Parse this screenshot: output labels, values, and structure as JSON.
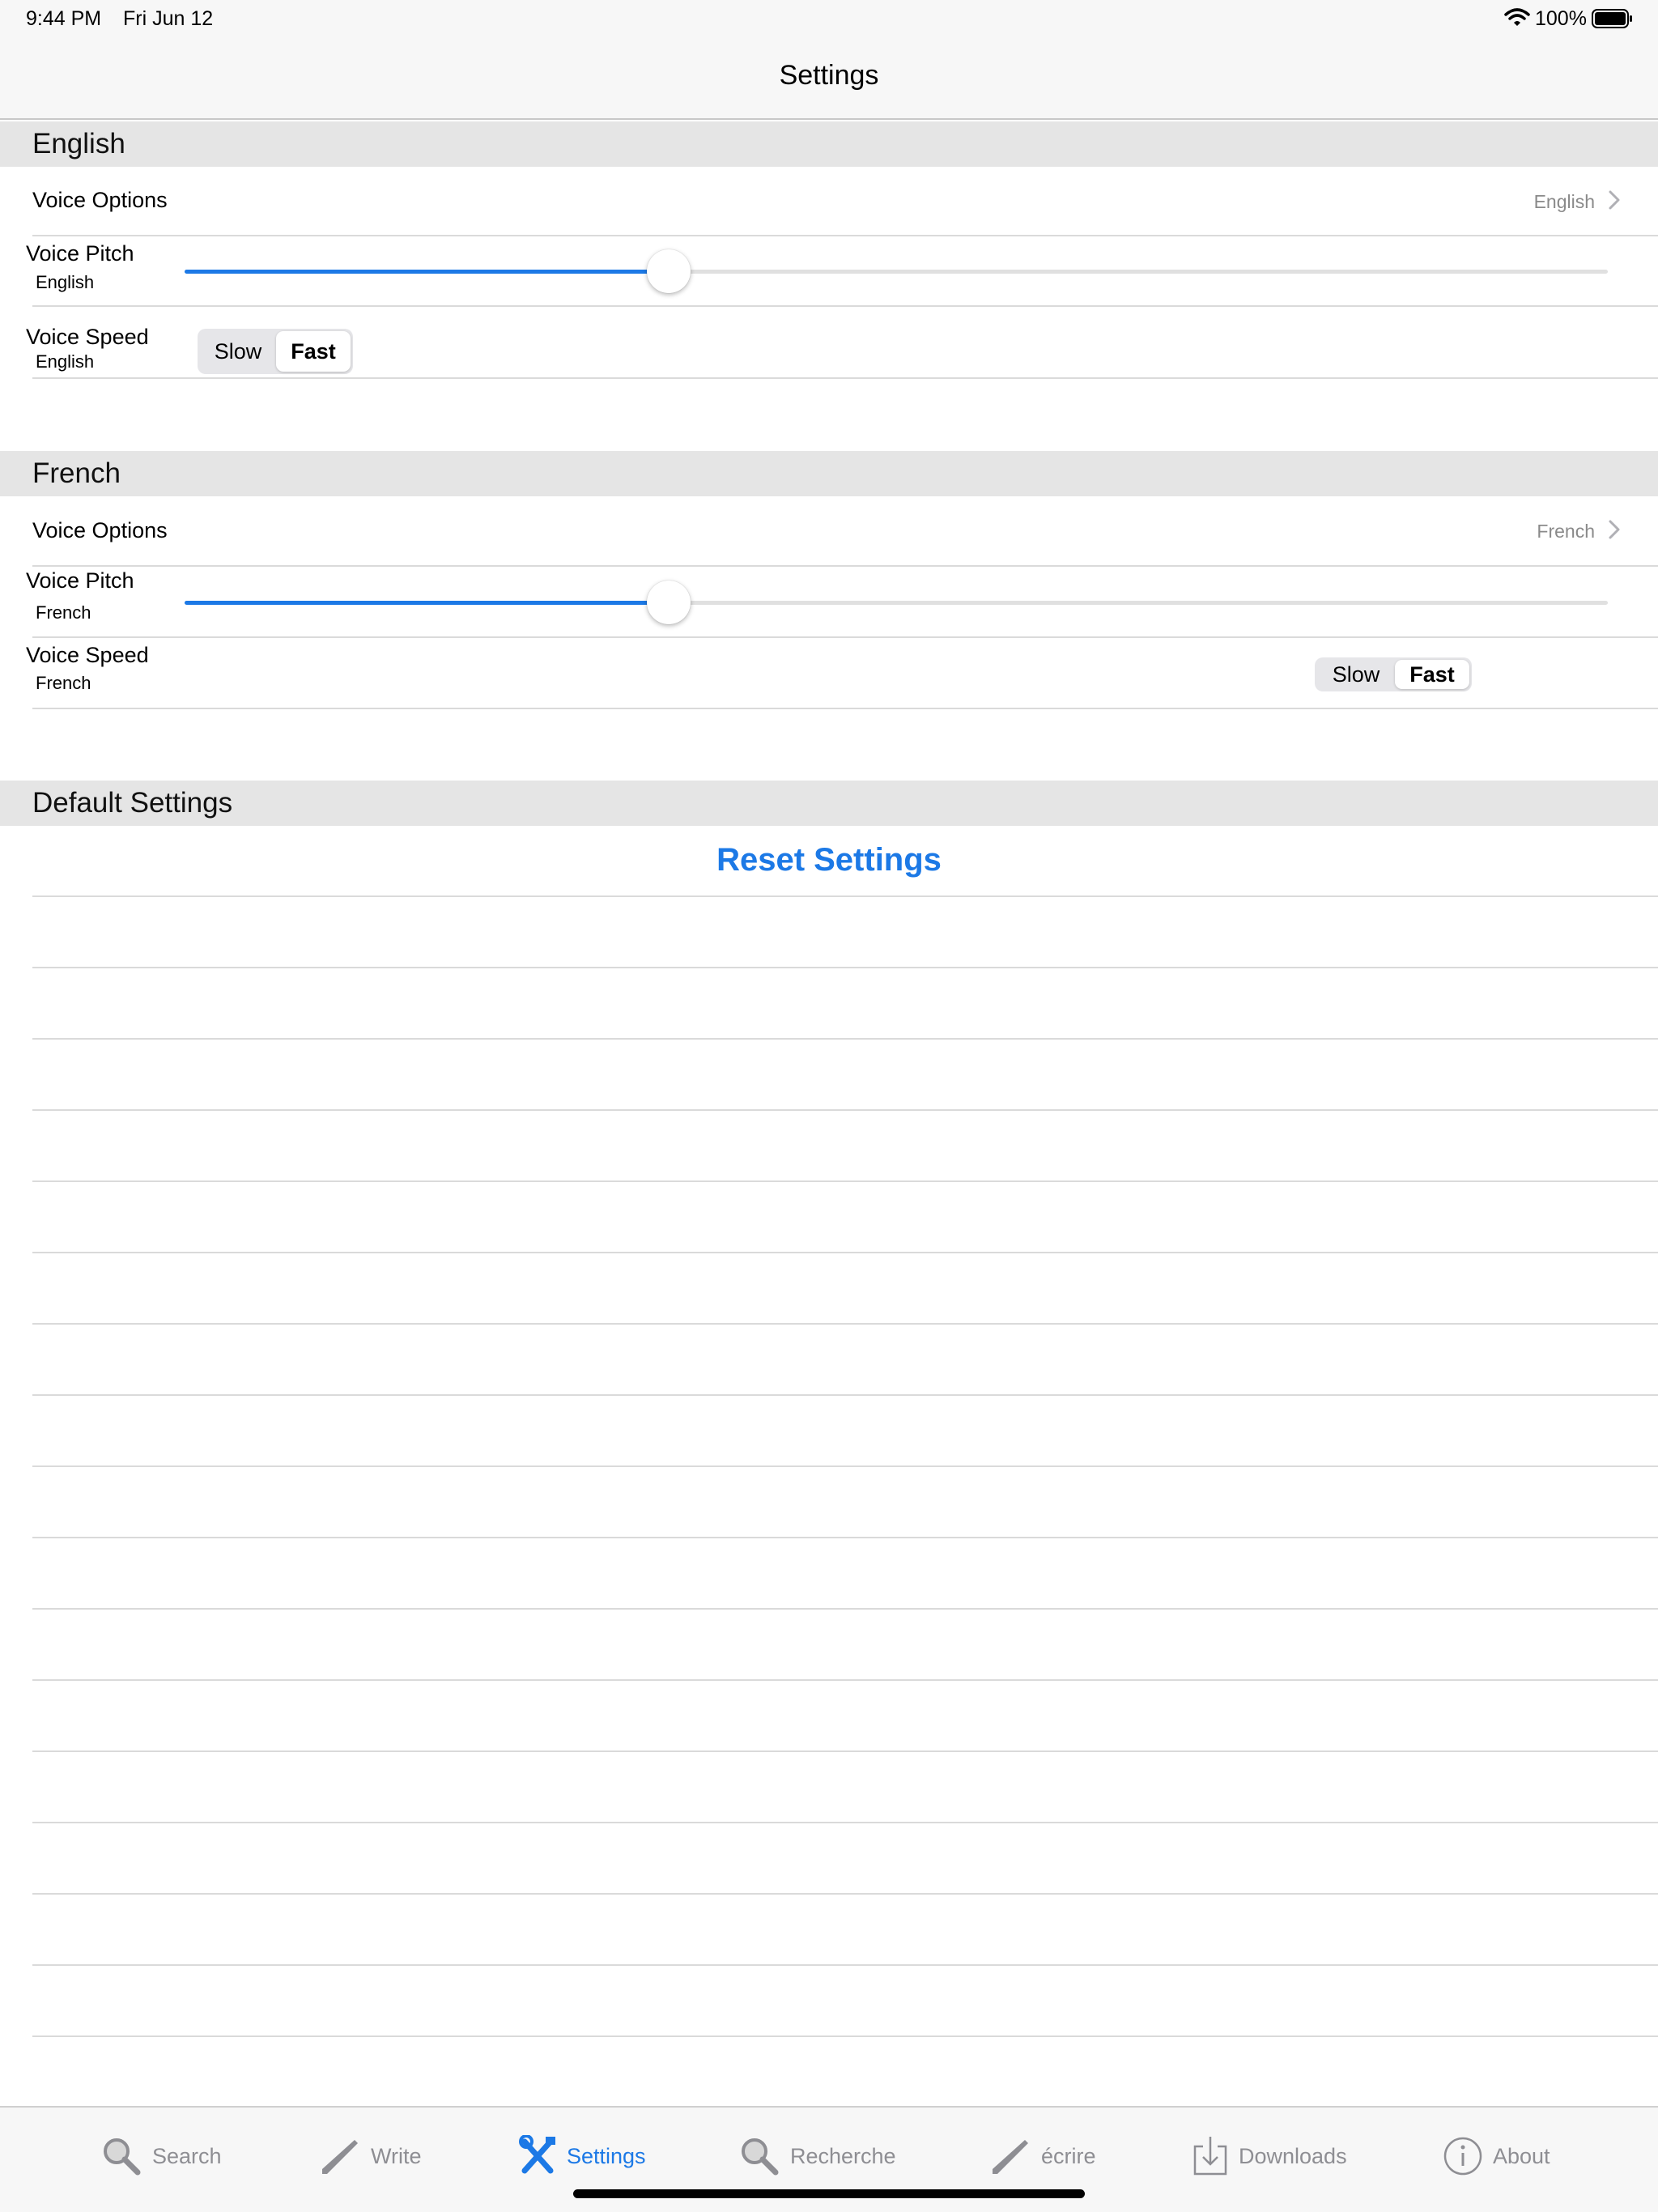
{
  "status_bar": {
    "time": "9:44 PM",
    "date": "Fri Jun 12",
    "battery": "100%",
    "wifi_icon": "wifi-icon",
    "battery_icon": "battery-icon"
  },
  "nav": {
    "title": "Settings"
  },
  "sections": {
    "english": {
      "header": "English",
      "voice_options_label": "Voice Options",
      "voice_options_value": "English",
      "pitch_label": "Voice Pitch",
      "pitch_sub": "English",
      "pitch_value": 0.34,
      "speed_label": "Voice Speed",
      "speed_sub": "English",
      "speed_options": [
        "Slow",
        "Fast"
      ],
      "speed_selected": "Fast"
    },
    "french": {
      "header": "French",
      "voice_options_label": "Voice Options",
      "voice_options_value": "French",
      "pitch_label": "Voice Pitch",
      "pitch_sub": "French",
      "pitch_value": 0.34,
      "speed_label": "Voice Speed",
      "speed_sub": "French",
      "speed_options": [
        "Slow",
        "Fast"
      ],
      "speed_selected": "Fast"
    },
    "default": {
      "header": "Default Settings",
      "reset_label": "Reset Settings"
    }
  },
  "tabs": [
    {
      "label": "Search",
      "icon": "magnifier-icon",
      "active": false
    },
    {
      "label": "Write",
      "icon": "pencil-icon",
      "active": false
    },
    {
      "label": "Settings",
      "icon": "tools-icon",
      "active": true
    },
    {
      "label": "Recherche",
      "icon": "magnifier-icon",
      "active": false
    },
    {
      "label": "écrire",
      "icon": "pencil-icon",
      "active": false
    },
    {
      "label": "Downloads",
      "icon": "download-icon",
      "active": false
    },
    {
      "label": "About",
      "icon": "info-icon",
      "active": false
    }
  ],
  "colors": {
    "accent": "#1c79e6",
    "section_header_bg": "#e5e5e5",
    "bar_bg": "#f7f7f7",
    "inactive_tab": "#8e8e93"
  }
}
